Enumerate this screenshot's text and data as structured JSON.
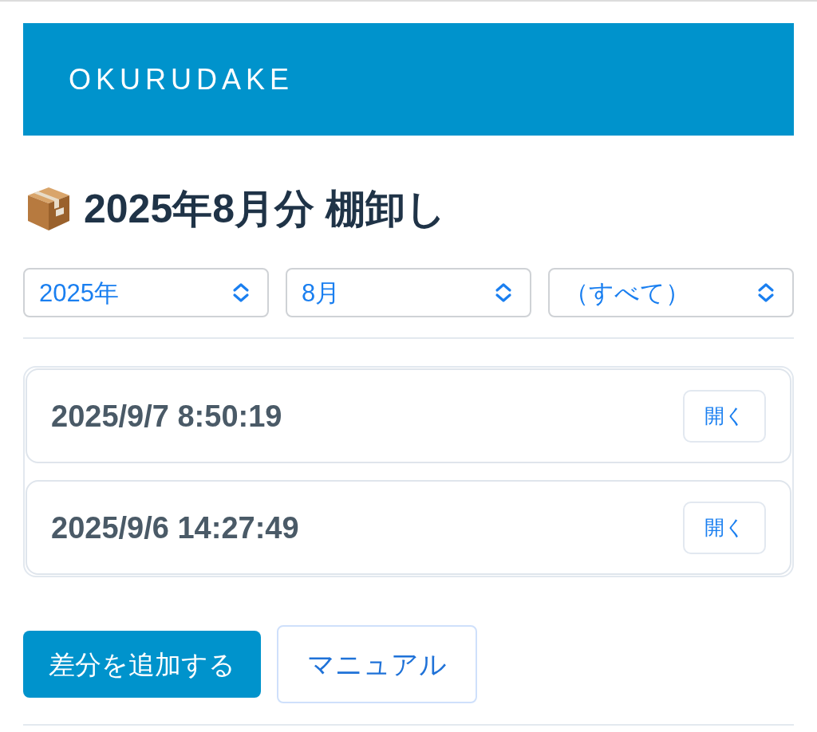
{
  "header": {
    "logo": "OKURUDAKE"
  },
  "title": {
    "text": "2025年8月分 棚卸し"
  },
  "filters": [
    {
      "value": "2025年"
    },
    {
      "value": "8月"
    },
    {
      "value": "（すべて）"
    }
  ],
  "records": [
    {
      "timestamp": "2025/9/7 8:50:19",
      "button": "開く"
    },
    {
      "timestamp": "2025/9/6 14:27:49",
      "button": "開く"
    }
  ],
  "actions": [
    {
      "label": "差分を追加する",
      "kind": "primary"
    },
    {
      "label": "マニュアル",
      "kind": "secondary"
    }
  ]
}
